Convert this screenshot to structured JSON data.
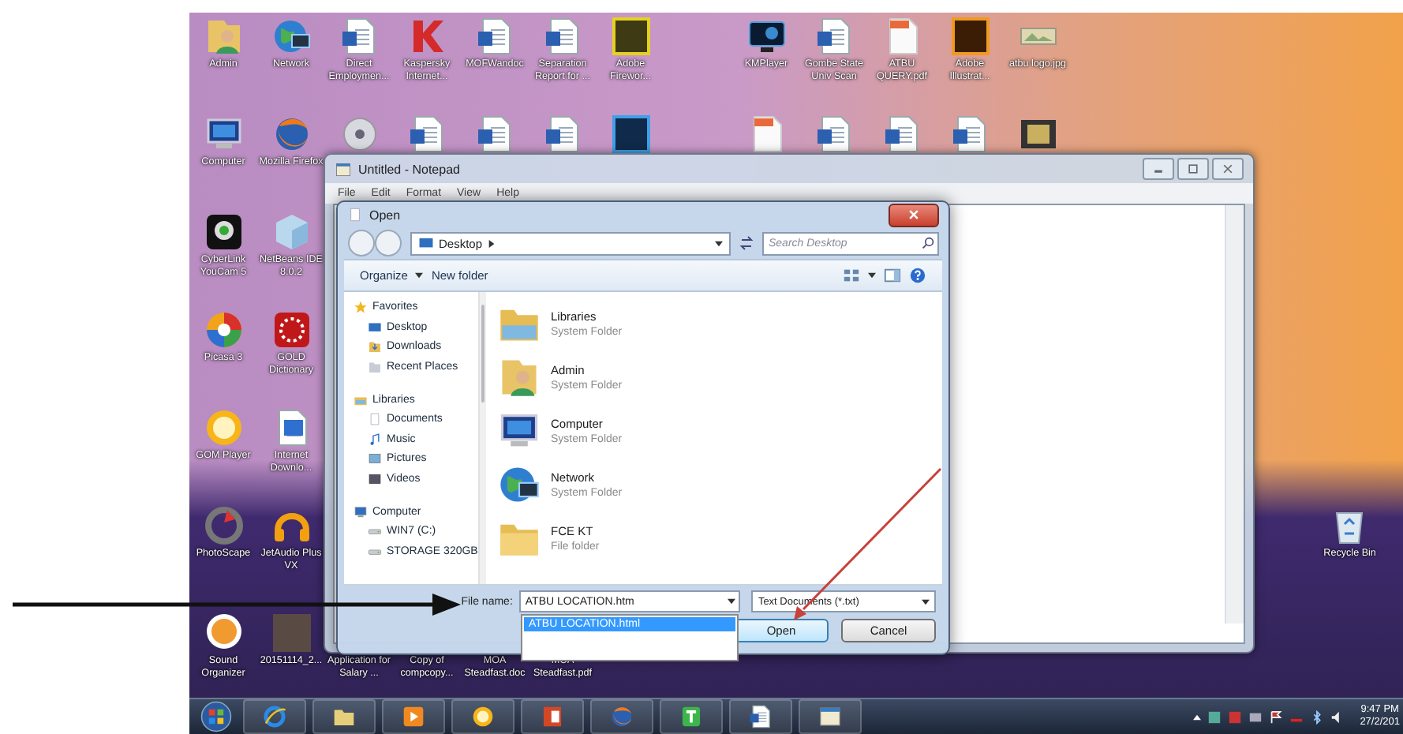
{
  "desktop_icons": [
    {
      "label": "Admin",
      "kind": "user-folder"
    },
    {
      "label": "Network",
      "kind": "globe"
    },
    {
      "label": "Direct Employmen...",
      "kind": "word"
    },
    {
      "label": "Kaspersky Internet...",
      "kind": "kaspersky"
    },
    {
      "label": "MOFWandoc",
      "kind": "word"
    },
    {
      "label": "Separation Report for ...",
      "kind": "word"
    },
    {
      "label": "Adobe Firewor...",
      "kind": "fireworks"
    },
    {
      "label": "KMPlayer",
      "kind": "kmplayer"
    },
    {
      "label": "Gombe State Univ Scan",
      "kind": "word"
    },
    {
      "label": "ATBU QUERY.pdf",
      "kind": "pdf"
    },
    {
      "label": "Adobe Illustrat...",
      "kind": "illustrator"
    },
    {
      "label": "atbu logo.jpg",
      "kind": "image"
    },
    {
      "label": "Computer",
      "kind": "computer"
    },
    {
      "label": "Mozilla Firefox",
      "kind": "firefox"
    },
    {
      "label": "CyberLink YouCam 5",
      "kind": "webcam"
    },
    {
      "label": "NetBeans IDE 8.0.2",
      "kind": "cube"
    },
    {
      "label": "Picasa 3",
      "kind": "pinwheel"
    },
    {
      "label": "GOLD Dictionary",
      "kind": "dictionary"
    },
    {
      "label": "GOM Player",
      "kind": "sun"
    },
    {
      "label": "Internet Downlo...",
      "kind": "grid-page"
    },
    {
      "label": "PhotoScape",
      "kind": "photoscape"
    },
    {
      "label": "JetAudio Plus VX",
      "kind": "jetaudio"
    },
    {
      "label": "Sound Organizer",
      "kind": "sound"
    },
    {
      "label": "20151114_2...",
      "kind": "photo"
    },
    {
      "label": "Application for Salary ...",
      "kind": "word"
    },
    {
      "label": "Copy of compcopy...",
      "kind": "word"
    },
    {
      "label": "MOA Steadfast.doc",
      "kind": "word"
    },
    {
      "label": "MOA Steadfast.pdf",
      "kind": "pdf"
    },
    {
      "label": "Recycle Bin",
      "kind": "recycle"
    }
  ],
  "hidden_row_icons": [
    {
      "kind": "disc"
    },
    {
      "kind": "word"
    },
    {
      "kind": "word"
    },
    {
      "kind": "word"
    },
    {
      "kind": "photoshop"
    },
    {
      "kind": "pdf"
    },
    {
      "kind": "word"
    },
    {
      "kind": "word"
    },
    {
      "kind": "word"
    },
    {
      "kind": "film"
    }
  ],
  "notepad": {
    "title": "Untitled - Notepad",
    "menu": [
      "File",
      "Edit",
      "Format",
      "View",
      "Help"
    ]
  },
  "open_dialog": {
    "title": "Open",
    "breadcrumb": "Desktop",
    "search": {
      "placeholder": "Search Desktop"
    },
    "toolbar": [
      "Organize",
      "New folder"
    ],
    "nav_tree": [
      {
        "label": "Favorites",
        "kind": "star",
        "children": [
          {
            "label": "Desktop",
            "kind": "desktop"
          },
          {
            "label": "Downloads",
            "kind": "downloads"
          },
          {
            "label": "Recent Places",
            "kind": "recent"
          }
        ]
      },
      {
        "label": "Libraries",
        "kind": "library",
        "children": [
          {
            "label": "Documents",
            "kind": "documents"
          },
          {
            "label": "Music",
            "kind": "music"
          },
          {
            "label": "Pictures",
            "kind": "pictures"
          },
          {
            "label": "Videos",
            "kind": "videos"
          }
        ]
      },
      {
        "label": "Computer",
        "kind": "computer-small",
        "children": [
          {
            "label": "WIN7 (C:)",
            "kind": "drive"
          },
          {
            "label": "STORAGE 320GB",
            "kind": "drive"
          }
        ]
      }
    ],
    "files": [
      {
        "name": "Libraries",
        "type": "System Folder",
        "kind": "library-folder"
      },
      {
        "name": "Admin",
        "type": "System Folder",
        "kind": "user-folder"
      },
      {
        "name": "Computer",
        "type": "System Folder",
        "kind": "computer"
      },
      {
        "name": "Network",
        "type": "System Folder",
        "kind": "globe"
      },
      {
        "name": "FCE KT",
        "type": "File folder",
        "kind": "folder"
      }
    ],
    "file_name": {
      "label": "File name:",
      "value": "ATBU LOCATION.htm"
    },
    "suggestions": [
      {
        "text": "ATBU LOCATION.html",
        "selected": true
      }
    ],
    "file_type": "Text Documents (*.txt)",
    "buttons": [
      {
        "label": "Open",
        "default": true
      },
      {
        "label": "Cancel",
        "default": false
      }
    ]
  },
  "taskbar": {
    "apps": [
      {
        "kind": "start"
      },
      {
        "kind": "ie"
      },
      {
        "kind": "explorer"
      },
      {
        "kind": "media"
      },
      {
        "kind": "gom"
      },
      {
        "kind": "powerpoint"
      },
      {
        "kind": "firefox"
      },
      {
        "kind": "t-app"
      },
      {
        "kind": "word"
      },
      {
        "kind": "notepad"
      }
    ],
    "clock": {
      "time": "9:47 PM",
      "date": "27/2/201"
    }
  }
}
